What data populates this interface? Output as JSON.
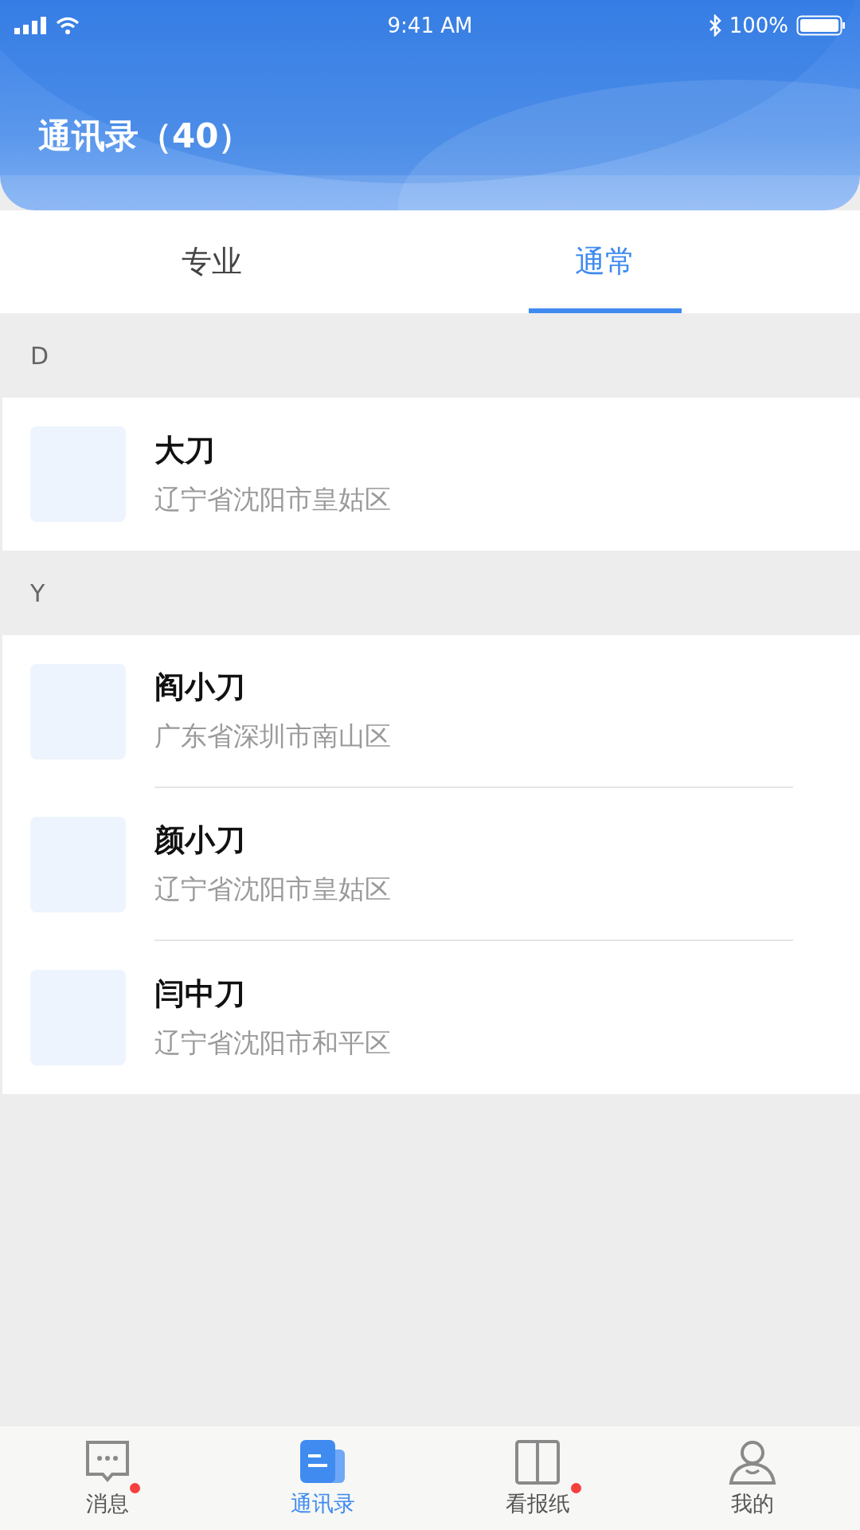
{
  "status_bar": {
    "time": "9:41 AM",
    "battery": "100%"
  },
  "header": {
    "title": "通讯录（40）"
  },
  "tabs": [
    {
      "label": "专业",
      "selected": false
    },
    {
      "label": "通常",
      "selected": true
    }
  ],
  "sections": [
    {
      "letter": "D",
      "contacts": [
        {
          "name": "大刀",
          "address": "辽宁省沈阳市皇姑区"
        }
      ]
    },
    {
      "letter": "Y",
      "contacts": [
        {
          "name": "阎小刀",
          "address": "广东省深圳市南山区"
        },
        {
          "name": "颜小刀",
          "address": "辽宁省沈阳市皇姑区"
        },
        {
          "name": "闫中刀",
          "address": "辽宁省沈阳市和平区"
        }
      ]
    }
  ],
  "bottom_nav": [
    {
      "kind": "message",
      "label": "消息",
      "selected": false,
      "dot": true
    },
    {
      "kind": "contacts",
      "label": "通讯录",
      "selected": true,
      "dot": false
    },
    {
      "kind": "book",
      "label": "看报纸",
      "selected": false,
      "dot": true
    },
    {
      "kind": "user",
      "label": "我的",
      "selected": false,
      "dot": false
    }
  ]
}
